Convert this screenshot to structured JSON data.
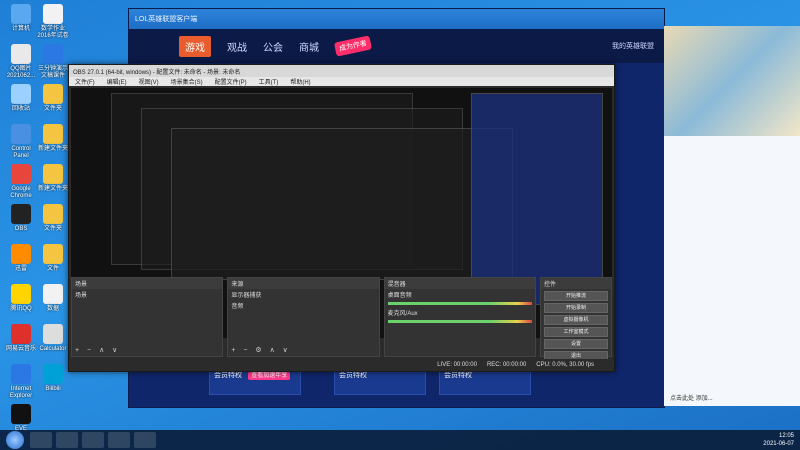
{
  "desktop": {
    "icons": [
      {
        "name": "computer",
        "label": "计算机",
        "color": "#5aa9f0"
      },
      {
        "name": "doc-a",
        "label": "数学作业2016年试卷",
        "color": "#f2f2f2"
      },
      {
        "name": "qq-img",
        "label": "QQ图片2021062...",
        "color": "#e9e9e9"
      },
      {
        "name": "word-doc",
        "label": "三分钟演示文稿课件",
        "color": "#2b78e4"
      },
      {
        "name": "recycle",
        "label": "回收站",
        "color": "#9bd0ff"
      },
      {
        "name": "folder",
        "label": "文件夹",
        "color": "#f5c542"
      },
      {
        "name": "control",
        "label": "Control Panel",
        "color": "#4a90e2"
      },
      {
        "name": "folder2",
        "label": "新建文件夹",
        "color": "#f5c542"
      },
      {
        "name": "chrome",
        "label": "Google Chrome",
        "color": "#e8453c"
      },
      {
        "name": "folder3",
        "label": "新建文件夹",
        "color": "#f5c542"
      },
      {
        "name": "obs",
        "label": "OBS",
        "color": "#222"
      },
      {
        "name": "folder4",
        "label": "文件夹",
        "color": "#f5c542"
      },
      {
        "name": "app1",
        "label": "迅雷",
        "color": "#ff8c00"
      },
      {
        "name": "folder5",
        "label": "文件",
        "color": "#f5c542"
      },
      {
        "name": "qq",
        "label": "腾讯QQ",
        "color": "#ffd400"
      },
      {
        "name": "excel",
        "label": "数据",
        "color": "#f2f2f2"
      },
      {
        "name": "app2",
        "label": "网易云音乐",
        "color": "#e0302c"
      },
      {
        "name": "calc",
        "label": "Calculator",
        "color": "#ddd"
      },
      {
        "name": "ie",
        "label": "Internet Explorer",
        "color": "#2b78e4"
      },
      {
        "name": "app3",
        "label": "Bilibili",
        "color": "#00a1d6"
      },
      {
        "name": "eve",
        "label": "EVE",
        "color": "#111"
      }
    ]
  },
  "app": {
    "title": "LOL英雄联盟客户端",
    "tabs": [
      "游戏",
      "观战",
      "公会",
      "商城"
    ],
    "badge": "成为作者",
    "user": "我的英雄联盟",
    "bottom_items": [
      "会员特权",
      "会员特权",
      "会员特权"
    ],
    "pink_label": "查看加速年享"
  },
  "obs": {
    "title": "OBS 27.0.1 (64-bit, windows) - 配置文件: 未命名 - 场景: 未命名",
    "menu": [
      "文件(F)",
      "编辑(E)",
      "视图(V)",
      "场景集合(S)",
      "配置文件(P)",
      "工具(T)",
      "帮助(H)"
    ],
    "docks": {
      "scenes": {
        "header": "场景",
        "items": [
          "场景"
        ]
      },
      "sources": {
        "header": "来源",
        "items": [
          "显示器捕获",
          "音频"
        ]
      },
      "mixer": {
        "header": "混音器",
        "items": [
          "桌面音频",
          "麦克风/Aux"
        ]
      },
      "controls": {
        "header": "控件",
        "buttons": [
          "开始推流",
          "开始录制",
          "虚拟摄像机",
          "工作室模式",
          "设置",
          "退出"
        ]
      }
    },
    "status": [
      "LIVE: 00:00:00",
      "REC: 00:00:00",
      "CPU: 0.0%, 30.00 fps"
    ]
  },
  "taskbar": {
    "time": "12:05",
    "date": "2021-06-07"
  },
  "rightpanel": {
    "footer": "点击此处 添加..."
  }
}
